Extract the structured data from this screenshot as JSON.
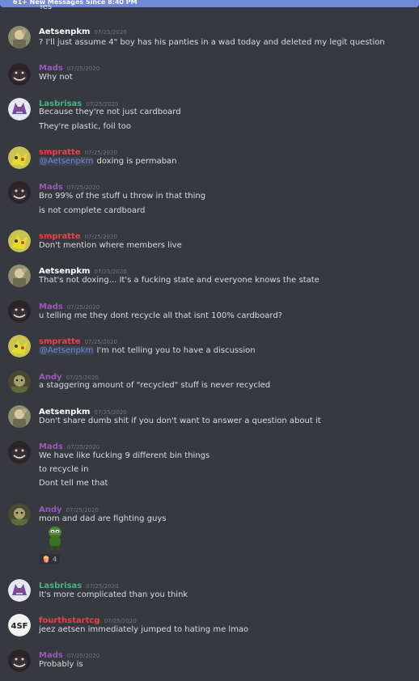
{
  "banner": {
    "text": "61+ New Messages Since 8:40 PM"
  },
  "cut_text": "Yes",
  "colors": {
    "background": "#36393f",
    "banner": "#7289da",
    "white_name": "#ffffff",
    "purple_name": "#9b59b6",
    "green_name": "#43b581",
    "red_name": "#ed4245",
    "mention": "#7289da"
  },
  "messages": [
    {
      "author": "Aetsenpkm",
      "time": "07/25/2020",
      "lines": [
        "? I'll just assume 4\" boy has his panties in a wad today and deleted my legit question"
      ]
    },
    {
      "author": "Mads",
      "time": "07/25/2020",
      "lines": [
        "Why not"
      ]
    },
    {
      "author": "Lasbrisas",
      "time": "07/25/2020",
      "lines": [
        "Because they're not just cardboard",
        "They're plastic, foil too"
      ]
    },
    {
      "author": "smpratte",
      "time": "07/25/2020",
      "mention": "@Aetsenpkm",
      "lines": [
        "doxing is permaban"
      ]
    },
    {
      "author": "Mads",
      "time": "07/25/2020",
      "lines": [
        "Bro 99% of the stuff u throw in that thing",
        "is not complete cardboard"
      ]
    },
    {
      "author": "smpratte",
      "time": "07/25/2020",
      "lines": [
        "Don't mention where members live"
      ]
    },
    {
      "author": "Aetsenpkm",
      "time": "07/25/2020",
      "lines": [
        "That's not doxing... It's a fucking state and everyone knows the state"
      ]
    },
    {
      "author": "Mads",
      "time": "07/25/2020",
      "lines": [
        "u telling me they dont recycle all that isnt 100% cardboard?"
      ]
    },
    {
      "author": "smpratte",
      "time": "07/25/2020",
      "mention": "@Aetsenpkm",
      "lines": [
        "I'm not telling you to have a discussion"
      ]
    },
    {
      "author": "Andy",
      "time": "07/25/2020",
      "lines": [
        "a staggering amount of \"recycled\" stuff is never recycled"
      ]
    },
    {
      "author": "Aetsenpkm",
      "time": "07/25/2020",
      "lines": [
        "Don't share dumb shit if you don't want to answer a question about it"
      ]
    },
    {
      "author": "Mads",
      "time": "07/25/2020",
      "lines": [
        "We have like fucking 9 different bin things",
        "to recycle in",
        "Dont tell me that"
      ]
    },
    {
      "author": "Andy",
      "time": "07/25/2020",
      "lines": [
        "mom and dad are fighting guys"
      ],
      "reaction": {
        "emoji": "popcorn-emoji",
        "count": "4"
      }
    },
    {
      "author": "Lasbrisas",
      "time": "07/25/2020",
      "lines": [
        "It's more complicated than you think"
      ]
    },
    {
      "author": "fourthstartcg",
      "time": "07/25/2020",
      "lines": [
        "jeez aetsen immediately jumped to hating me lmao"
      ]
    },
    {
      "author": "Mads",
      "time": "07/25/2020",
      "lines": [
        "Probably is"
      ]
    }
  ]
}
